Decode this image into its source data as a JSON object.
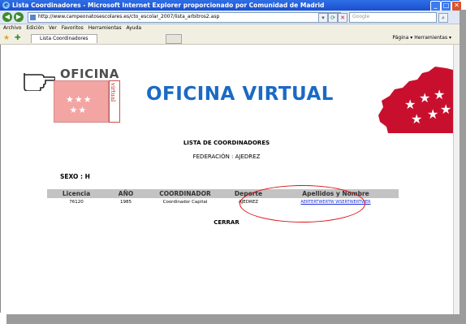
{
  "window": {
    "title": "Lista Coordinadores - Microsoft Internet Explorer proporcionado por Comunidad de Madrid",
    "url": "http://www.campeonatosescolares.es/cto_escolar_2007/lista_arbitros2.asp",
    "search_placeholder": "Google",
    "menu": [
      "Archivo",
      "Edición",
      "Ver",
      "Favoritos",
      "Herramientas",
      "Ayuda"
    ],
    "tab_label": "Lista Coordinadores",
    "toolbar_right": "Página ▾  Herramientas ▾"
  },
  "header": {
    "logo_text": "OFICINA",
    "logo_vertical": "virtual",
    "title": "OFICINA VIRTUAL"
  },
  "page": {
    "heading": "LISTA DE COORDINADORES",
    "federacion": "FEDERACIÓN : AJEDREZ",
    "sexo": "SEXO : H",
    "close": "CERRAR"
  },
  "table": {
    "headers": [
      "Licencia",
      "AÑO",
      "COORDINADOR",
      "Deporte",
      "Apellidos y Nombre"
    ],
    "rows": [
      [
        "76120",
        "1985",
        "Coordinador Capital",
        "AJEDREZ",
        "AERTERTWERTW WSERTWERTWER"
      ]
    ]
  },
  "colors": {
    "title_blue": "#1b6ac4",
    "highlight_red": "#d11111",
    "header_gray": "#c3c3c3"
  }
}
